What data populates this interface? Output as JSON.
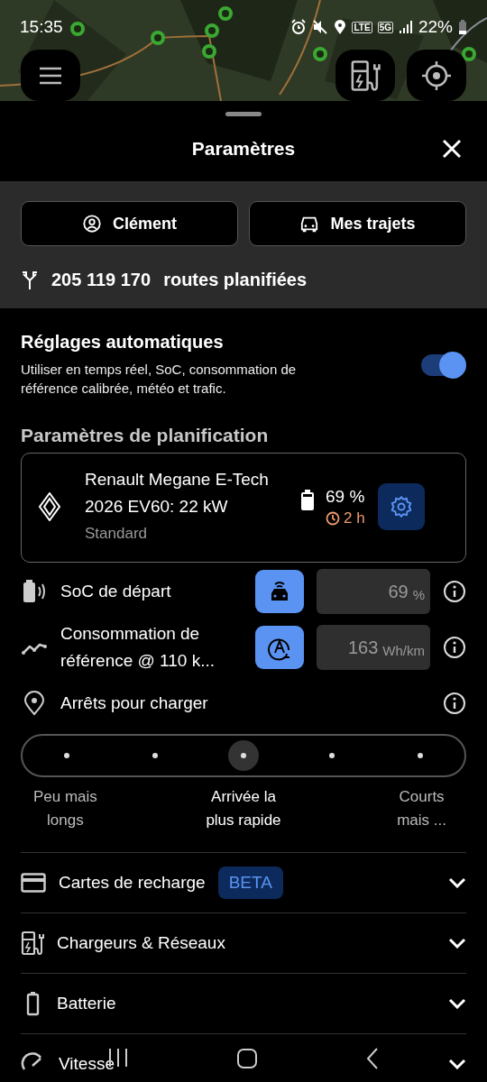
{
  "status_bar": {
    "time": "15:35",
    "network": [
      "LTE",
      "5G"
    ],
    "battery": "22%"
  },
  "sheet": {
    "title": "Paramètres"
  },
  "account_buttons": [
    {
      "kind": "user",
      "label": "Clément"
    },
    {
      "kind": "car",
      "label": "Mes trajets"
    }
  ],
  "routes": {
    "count": "205 119 170",
    "label": "routes planifiées"
  },
  "auto_settings": {
    "title": "Réglages automatiques",
    "description": "Utiliser en temps réel, SoC, consommation de référence calibrée, météo et trafic.",
    "on": true
  },
  "planning": {
    "title": "Paramètres de planification",
    "vehicle": {
      "name": "Renault Megane E-Tech 2026 EV60: 22 kW",
      "variant": "Standard",
      "soc": "69 %",
      "time": "2 h"
    },
    "rows": [
      {
        "kind": "soc",
        "label": "SoC de départ",
        "on": true,
        "value": "69",
        "unit": "%"
      },
      {
        "kind": "consumption",
        "label": "Consommation de référence @ 110 k...",
        "on": true,
        "value": "163",
        "unit": "Wh/km"
      }
    ]
  },
  "charging_stops": {
    "label": "Arrêts pour charger",
    "stops": [
      {
        "selected": false,
        "label": "Peu mais longs"
      },
      {
        "selected": false
      },
      {
        "selected": true,
        "label": "Arrivée la plus rapide"
      },
      {
        "selected": false
      },
      {
        "selected": false,
        "label": "Courts mais ..."
      }
    ]
  },
  "sections": [
    {
      "kind": "card",
      "label": "Cartes de recharge",
      "badge": "BETA",
      "expanded": false
    },
    {
      "kind": "charger",
      "label": "Chargeurs & Réseaux",
      "expanded": false
    },
    {
      "kind": "battery",
      "label": "Batterie",
      "expanded": false
    },
    {
      "kind": "speed",
      "label": "Vitesse",
      "expanded": false
    }
  ]
}
